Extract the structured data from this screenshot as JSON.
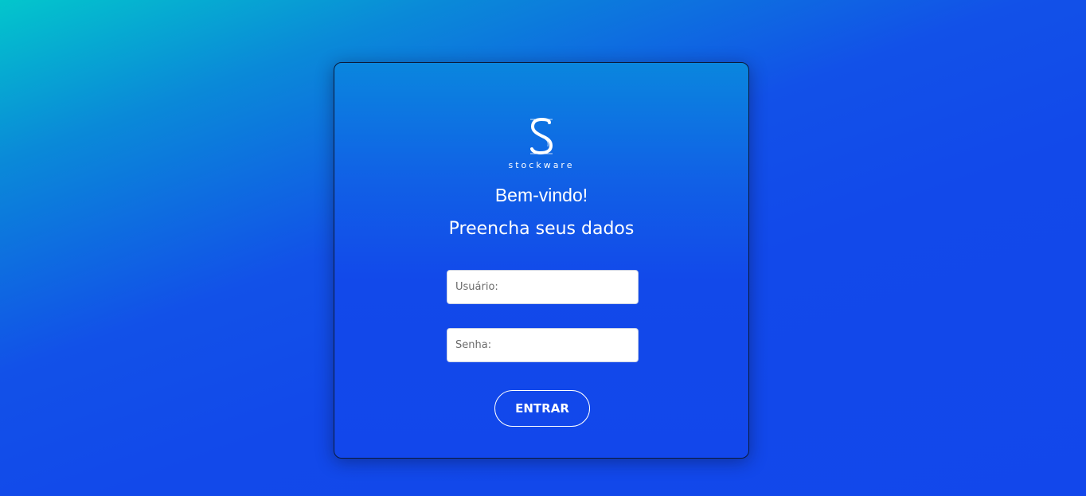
{
  "logo": {
    "icon": "stockware-s-logo-icon",
    "text": "stockware"
  },
  "header": {
    "welcome": "Bem-vindo!",
    "subtitle": "Preencha seus dados"
  },
  "form": {
    "username_placeholder": "Usuário:",
    "username_value": "",
    "password_placeholder": "Senha:",
    "password_value": "",
    "submit_label": "ENTRAR"
  },
  "colors": {
    "background_start": "#03c6cc",
    "background_end": "#1247eb",
    "text": "#ffffff"
  }
}
